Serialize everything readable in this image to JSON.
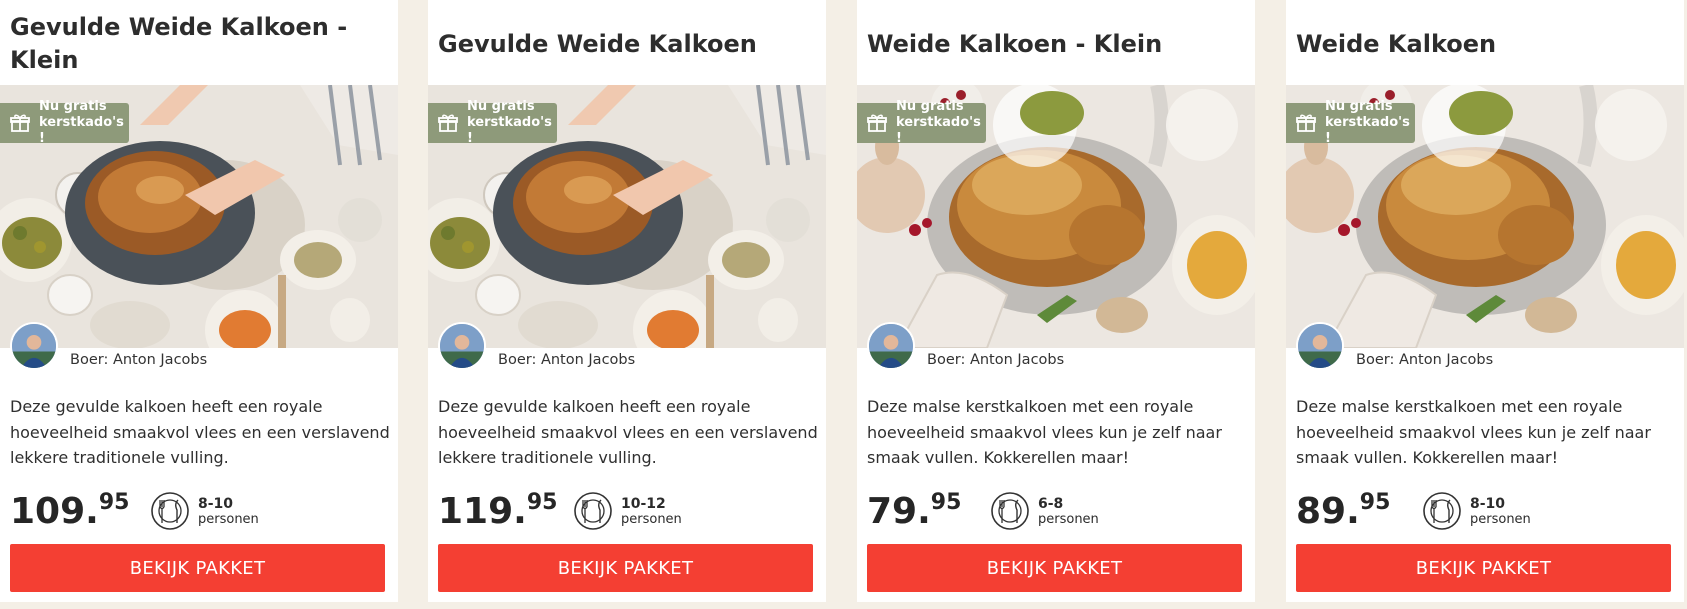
{
  "colors": {
    "accent": "#f43f33",
    "badge": "#8e9a7a",
    "background": "#f4efe6"
  },
  "cards": [
    {
      "title": "Gevulde Weide Kalkoen - Klein",
      "badge_line1": "Nu gratis",
      "badge_line2": "kerstkado's !",
      "farmer": "Boer: Anton Jacobs",
      "description": "Deze gevulde kalkoen heeft een royale hoeveelheid smaakvol vlees en een verslavend lekkere traditionele vulling.",
      "price_euros": "109",
      "price_dot": ".",
      "price_cents": "95",
      "persons_range": "8-10",
      "persons_label": "personen",
      "button": "BEKIJK PAKKET",
      "photo": "carving-turkey-photo"
    },
    {
      "title": "Gevulde Weide Kalkoen",
      "badge_line1": "Nu gratis",
      "badge_line2": "kerstkado's !",
      "farmer": "Boer: Anton Jacobs",
      "description": "Deze gevulde kalkoen heeft een royale hoeveelheid smaakvol vlees en een verslavend lekkere traditionele vulling.",
      "price_euros": "119",
      "price_dot": ".",
      "price_cents": "95",
      "persons_range": "10-12",
      "persons_label": "personen",
      "button": "BEKIJK PAKKET",
      "photo": "carving-turkey-photo"
    },
    {
      "title": "Weide Kalkoen - Klein",
      "badge_line1": "Nu gratis",
      "badge_line2": "kerstkado's !",
      "farmer": "Boer: Anton Jacobs",
      "description": "Deze malse kerstkalkoen met een royale hoeveelheid smaakvol vlees kun je zelf naar smaak vullen. Kokkerellen maar!",
      "price_euros": "79",
      "price_dot": ".",
      "price_cents": "95",
      "persons_range": "6-8",
      "persons_label": "personen",
      "button": "BEKIJK PAKKET",
      "photo": "roast-turkey-photo"
    },
    {
      "title": "Weide Kalkoen",
      "badge_line1": "Nu gratis",
      "badge_line2": "kerstkado's !",
      "farmer": "Boer: Anton Jacobs",
      "description": "Deze malse kerstkalkoen met een royale hoeveelheid smaakvol vlees kun je zelf naar smaak vullen. Kokkerellen maar!",
      "price_euros": "89",
      "price_dot": ".",
      "price_cents": "95",
      "persons_range": "8-10",
      "persons_label": "personen",
      "button": "BEKIJK PAKKET",
      "photo": "roast-turkey-photo"
    }
  ]
}
